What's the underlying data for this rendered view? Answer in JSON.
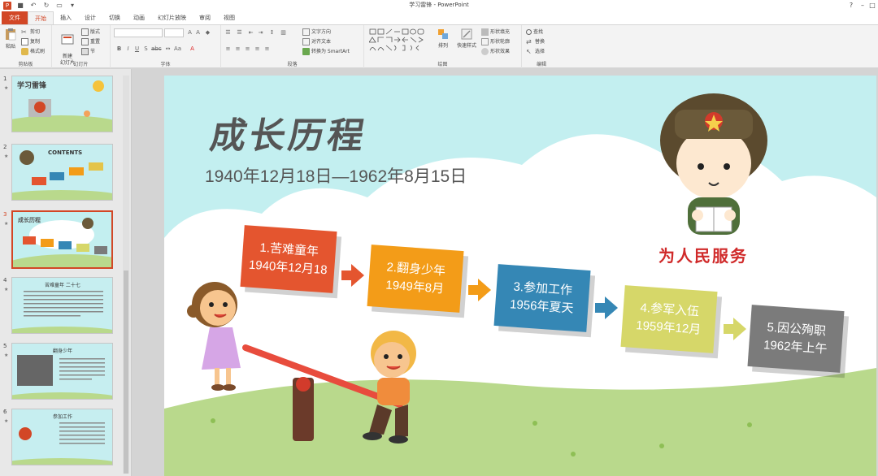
{
  "window": {
    "title": "学习雷锋 - PowerPoint",
    "help": "?",
    "minimize": "–",
    "restore": "□",
    "close": "✕"
  },
  "tabs": [
    "文件",
    "开始",
    "插入",
    "设计",
    "切换",
    "动画",
    "幻灯片放映",
    "审阅",
    "视图"
  ],
  "ribbon": {
    "clipboard": {
      "paste": "粘贴",
      "cut": "剪切",
      "copy": "复制",
      "format_painter": "格式刷",
      "group": "剪贴板"
    },
    "slides": {
      "new_slide": "新建\n幻灯片",
      "layout": "版式",
      "reset": "重置",
      "section": "节",
      "group": "幻灯片"
    },
    "font": {
      "group": "字体"
    },
    "paragraph": {
      "text_direction": "文字方向",
      "align_text": "对齐文本",
      "convert_smartart": "转换为 SmartArt",
      "group": "段落"
    },
    "drawing": {
      "arrange": "排列",
      "quick_styles": "快速样式",
      "shape_fill": "形状填充",
      "shape_outline": "形状轮廓",
      "shape_effects": "形状效果",
      "group": "绘图"
    },
    "editing": {
      "find": "查找",
      "replace": "替换",
      "select": "选择",
      "group": "编辑"
    }
  },
  "thumbnails": [
    {
      "num": "1",
      "title": "学习雷锋"
    },
    {
      "num": "2",
      "title": "CONTENTS"
    },
    {
      "num": "3",
      "title": "成长历程"
    },
    {
      "num": "4",
      "title": "苦难童年 二十七"
    },
    {
      "num": "5",
      "title": "翻身少年"
    },
    {
      "num": "6",
      "title": "参加工作"
    }
  ],
  "slide": {
    "title": "成长历程",
    "date_range": "1940年12月18日—1962年8月15日",
    "motto": "为人民服务",
    "steps": [
      {
        "line1": "1.苦难童年",
        "line2": "1940年12月18",
        "color": "#e4552f"
      },
      {
        "line1": "2.翻身少年",
        "line2": "1949年8月",
        "color": "#f39c18"
      },
      {
        "line1": "3.参加工作",
        "line2": "1956年夏天",
        "color": "#3587b5"
      },
      {
        "line1": "4.参军入伍",
        "line2": "1959年12月",
        "color": "#d6d769"
      },
      {
        "line1": "5.因公殉职",
        "line2": "1962年上午",
        "color": "#7b7b7b"
      }
    ]
  },
  "colors": {
    "accent": "#d24726",
    "sky": "#c3eff0",
    "grass": "#b9d98c"
  }
}
